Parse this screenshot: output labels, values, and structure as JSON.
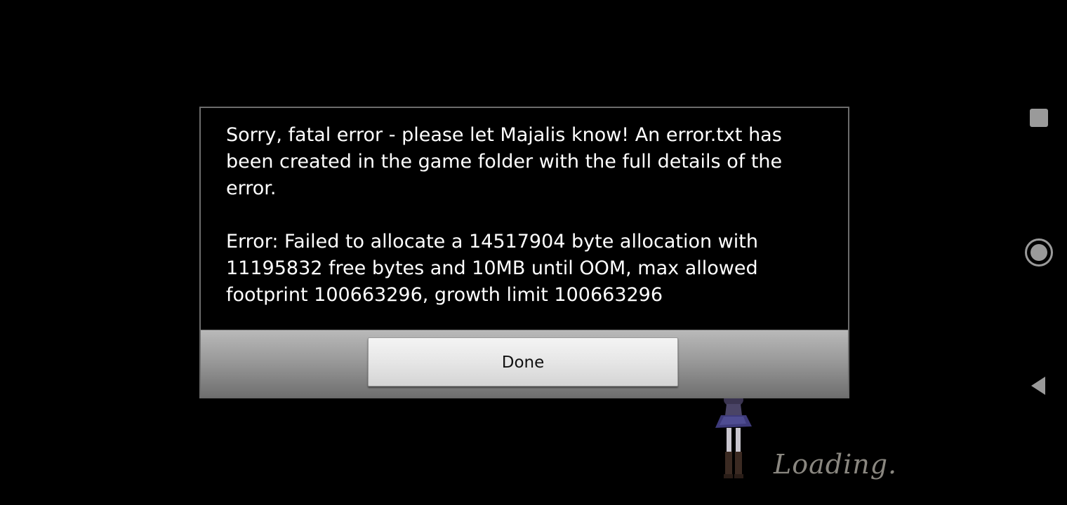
{
  "dialog": {
    "message": "Sorry, fatal error - please let Majalis know! An error.txt has\nbeen created in the game folder with the full details of the\nerror.\n\nError: Failed to allocate a 14517904 byte allocation with\n11195832 free bytes and 10MB until OOM, max allowed\nfootprint 100663296, growth limit 100663296",
    "done_label": "Done"
  },
  "background": {
    "loading_text": "Loading."
  },
  "nav_bar": {
    "icons": [
      "recents-icon",
      "home-icon",
      "back-icon"
    ]
  },
  "colors": {
    "background": "#000000",
    "dialog_border": "#6c6c6c",
    "dialog_text": "#ffffff",
    "nav_icon": "#9a9a9a",
    "loading_text": "#8a8780"
  }
}
